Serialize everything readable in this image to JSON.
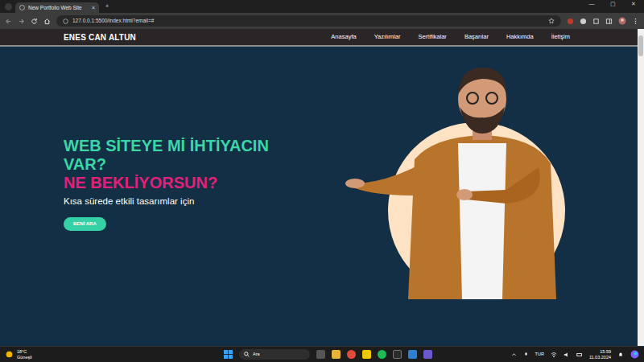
{
  "browser": {
    "tab": {
      "title": "New Portfolio Web Site",
      "close": "×",
      "selected": true
    },
    "new_tab": "+",
    "address": "127.0.0.1:5500/index.html?email=#",
    "window_controls": [
      "—",
      "▢",
      "✕"
    ]
  },
  "site": {
    "brand": "ENES CAN ALTUN",
    "nav": [
      {
        "label": "Anasayfa"
      },
      {
        "label": "Yazılımlar"
      },
      {
        "label": "Sertifikalar"
      },
      {
        "label": "Başarılar"
      },
      {
        "label": "Hakkımda"
      },
      {
        "label": "İletişim"
      }
    ]
  },
  "hero": {
    "heading": "WEB SİTEYE Mİ İHTİYACIN VAR?",
    "highlight": "NE BEKLİYORSUN?",
    "subtitle": "Kısa sürede etkili tasarımlar için",
    "button": "BENİ ARA"
  },
  "taskbar": {
    "weather": {
      "temp": "18°C",
      "desc": "Güneşli"
    },
    "search": "Ara",
    "language": "TUR",
    "time": "15:59",
    "date": "11.03.2024"
  }
}
